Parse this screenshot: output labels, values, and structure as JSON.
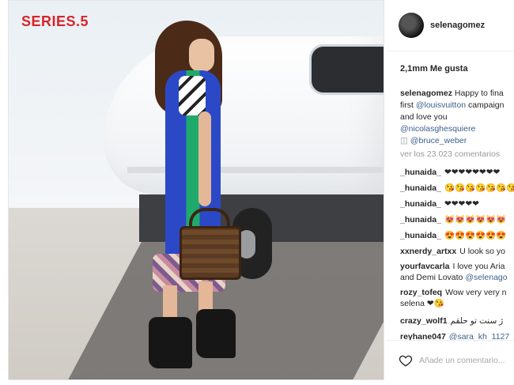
{
  "photo": {
    "brand_logo": "SERIES.5"
  },
  "post": {
    "username": "selenagomez",
    "likes": "2,1mm Me gusta",
    "caption": {
      "user": "selenagomez",
      "line1": "Happy to fina",
      "line2_prefix": "first ",
      "line2_link": "@louisvuitton",
      "line2_suffix": " campaign",
      "line3": "and love you",
      "line4_link": "@nicolasghesquiere",
      "line5_icon": "camera-icon",
      "line5_link": "@bruce_weber"
    },
    "more_comments": "ver los 23.023 comentarios",
    "comments": [
      {
        "user": "_hunaida_",
        "text": "❤❤❤❤❤❤❤❤"
      },
      {
        "user": "_hunaida_",
        "text": "😘😘😘😘😘😘😘"
      },
      {
        "user": "_hunaida_",
        "text": "❤❤❤❤❤"
      },
      {
        "user": "_hunaida_",
        "text": "😻😻😻😻😻😻"
      },
      {
        "user": "_hunaida_",
        "text": "😍😍😍😍😍😍"
      },
      {
        "user": "xxnerdy_artxx",
        "text": "U look so yo"
      },
      {
        "user": "yourfavcarla",
        "text": "I love you Aria",
        "line2": "and Demi Lovato ",
        "line2_link": "@selenago"
      },
      {
        "user": "rozy_tofeq",
        "text": "Wow very very n",
        "line2": "selena ❤😘"
      },
      {
        "user": "crazy_wolf1",
        "text": "ژ سنت تو حلقم"
      },
      {
        "user": "reyhane047",
        "text": "@sara_kh_1127"
      }
    ],
    "add_comment_placeholder": "Añade un comentario..."
  }
}
